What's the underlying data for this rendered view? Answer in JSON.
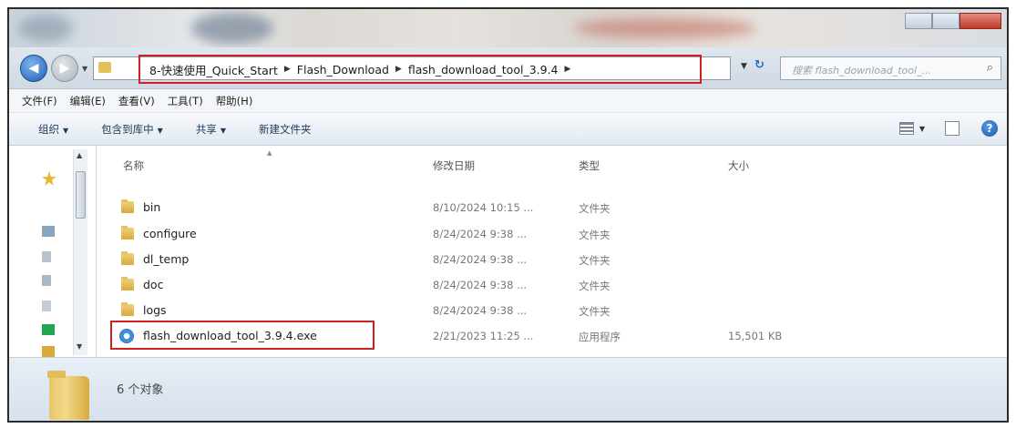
{
  "breadcrumb": [
    "8-快速使用_Quick_Start",
    "Flash_Download",
    "flash_download_tool_3.9.4"
  ],
  "search": {
    "placeholder": "搜索 flash_download_tool_..."
  },
  "menu": [
    "文件(F)",
    "编辑(E)",
    "查看(V)",
    "工具(T)",
    "帮助(H)"
  ],
  "commands": {
    "organize": "组织",
    "include_in_library": "包含到库中",
    "share": "共享",
    "new_folder": "新建文件夹"
  },
  "columns": {
    "name": "名称",
    "date": "修改日期",
    "type": "类型",
    "size": "大小"
  },
  "files": [
    {
      "name": "bin",
      "date": "8/10/2024 10:15 ...",
      "type": "文件夹",
      "size": "",
      "icon": "folder-icon"
    },
    {
      "name": "configure",
      "date": "8/24/2024 9:38 ...",
      "type": "文件夹",
      "size": "",
      "icon": "folder-icon"
    },
    {
      "name": "dl_temp",
      "date": "8/24/2024 9:38 ...",
      "type": "文件夹",
      "size": "",
      "icon": "folder-icon"
    },
    {
      "name": "doc",
      "date": "8/24/2024 9:38 ...",
      "type": "文件夹",
      "size": "",
      "icon": "folder-icon"
    },
    {
      "name": "logs",
      "date": "8/24/2024 9:38 ...",
      "type": "文件夹",
      "size": "",
      "icon": "folder-icon"
    },
    {
      "name": "flash_download_tool_3.9.4.exe",
      "date": "2/21/2023 11:25 ...",
      "type": "应用程序",
      "size": "15,501 KB",
      "icon": "app-icon"
    }
  ],
  "status": {
    "object_count": "6 个对象"
  },
  "colors": {
    "highlight": "#d11f1f",
    "folder": "#e5c05a",
    "accent": "#1f5fb3"
  }
}
